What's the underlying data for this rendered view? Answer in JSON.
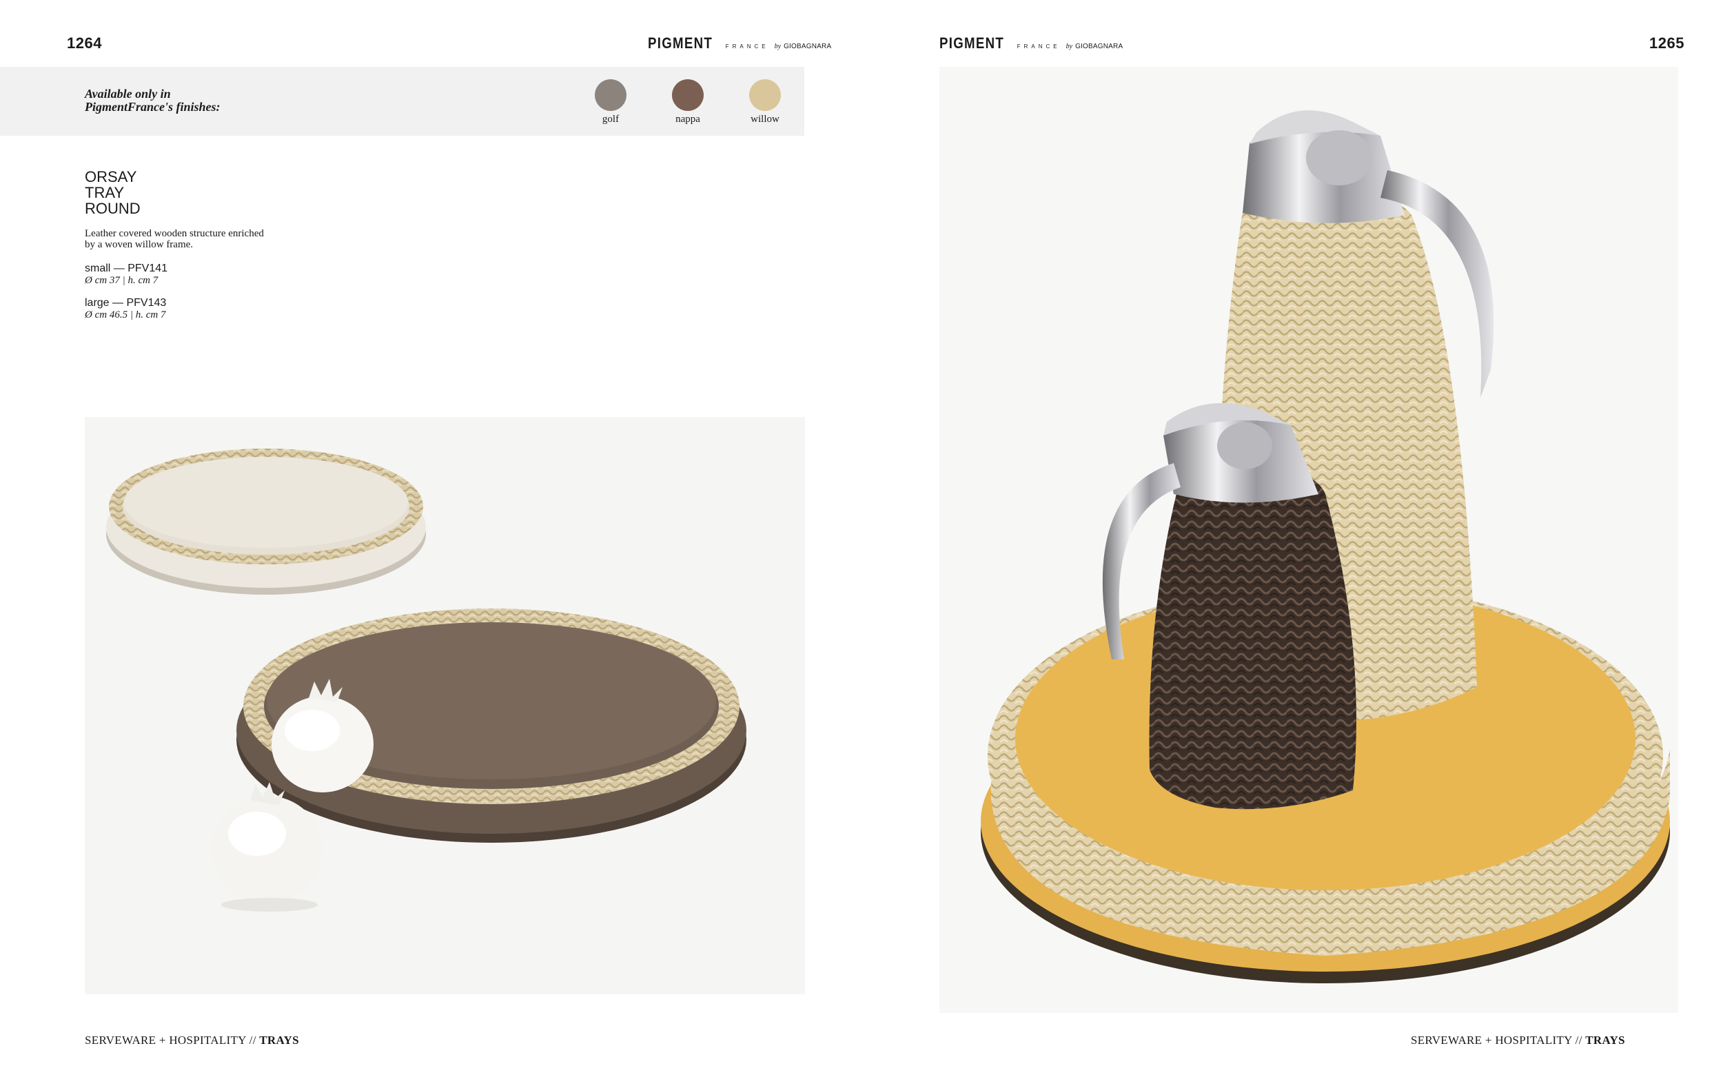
{
  "left_page": {
    "page_number": "1264",
    "brand": {
      "main": "PIGMENT",
      "sub": "FRANCE",
      "by": "by",
      "maker": "GIOBAGNARA"
    },
    "finishes": {
      "label_line1": "Available only in",
      "label_line2": "PigmentFrance's finishes:",
      "swatches": [
        {
          "name": "golf",
          "color": "#8c847c"
        },
        {
          "name": "nappa",
          "color": "#7a5f52"
        },
        {
          "name": "willow",
          "color": "#d9c69a"
        }
      ]
    },
    "product": {
      "title_lines": [
        "ORSAY",
        "TRAY",
        "ROUND"
      ],
      "description_line1": "Leather covered wooden structure enriched",
      "description_line2": "by a woven willow frame.",
      "sizes": [
        {
          "name": "small — PFV141",
          "dimensions": "Ø cm 37 | h. cm 7"
        },
        {
          "name": "large — PFV143",
          "dimensions": "Ø cm 46.5 | h. cm 7"
        }
      ]
    },
    "footer": {
      "section": "SERVEWARE + HOSPITALITY //",
      "category": "TRAYS"
    }
  },
  "right_page": {
    "page_number": "1265",
    "brand": {
      "main": "PIGMENT",
      "sub": "FRANCE",
      "by": "by",
      "maker": "GIOBAGNARA"
    },
    "footer": {
      "section": "SERVEWARE + HOSPITALITY //",
      "category": "TRAYS"
    }
  },
  "colors": {
    "willow": "#d8c9a4",
    "willow_dark": "#b9a47a",
    "tray_cream": "#e4ddd0",
    "tray_brown": "#6b5a4d",
    "tray_yellow": "#e7b650",
    "rattan_dark": "#3f322b",
    "chrome": "#c9c9cc"
  }
}
